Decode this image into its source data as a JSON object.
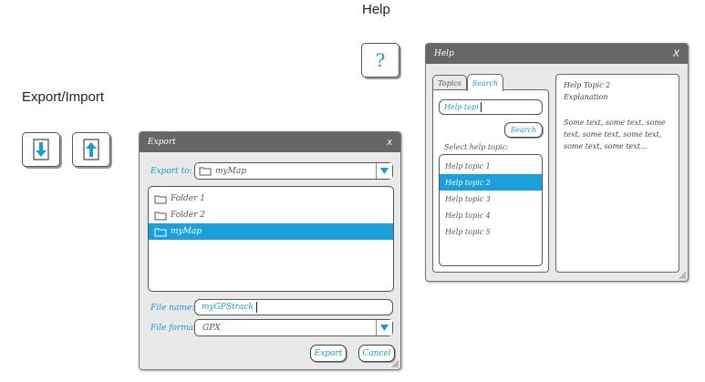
{
  "headings": {
    "help": "Help",
    "export_import": "Export/Import"
  },
  "icons": {
    "help": "question-mark-icon",
    "export": "download-arrow-icon",
    "import": "upload-arrow-icon"
  },
  "export_dialog": {
    "title": "Export",
    "close": "x",
    "export_to_label": "Export to:",
    "export_to_value": "myMap",
    "folders": [
      {
        "name": "Folder 1",
        "selected": false
      },
      {
        "name": "Folder 2",
        "selected": false
      },
      {
        "name": "myMap",
        "selected": true
      }
    ],
    "file_name_label": "File name:",
    "file_name_value": "myGPStrack",
    "file_format_label": "File format:",
    "file_format_value": "GPX",
    "export_button": "Export",
    "cancel_button": "Cancel"
  },
  "help_dialog": {
    "title": "Help",
    "close": "X",
    "tabs": [
      {
        "label": "Topics",
        "active": false
      },
      {
        "label": "Search",
        "active": true
      }
    ],
    "search_value": "Help topi",
    "search_button": "Search",
    "select_label": "Select help topic:",
    "topics": [
      {
        "label": "Help topic 1",
        "selected": false
      },
      {
        "label": "Help topic 2",
        "selected": true
      },
      {
        "label": "Help topic 3",
        "selected": false
      },
      {
        "label": "Help topic 4",
        "selected": false
      },
      {
        "label": "Help topic 5",
        "selected": false
      }
    ],
    "content_title": "Help Topic 2",
    "content_subtitle": "Explanation",
    "content_body": "Some text, some text, some text, some text, some text, some text, some text..."
  },
  "colors": {
    "accent": "#1aa0dc",
    "titlebar": "#666666",
    "window_bg": "#e9e9e9"
  }
}
